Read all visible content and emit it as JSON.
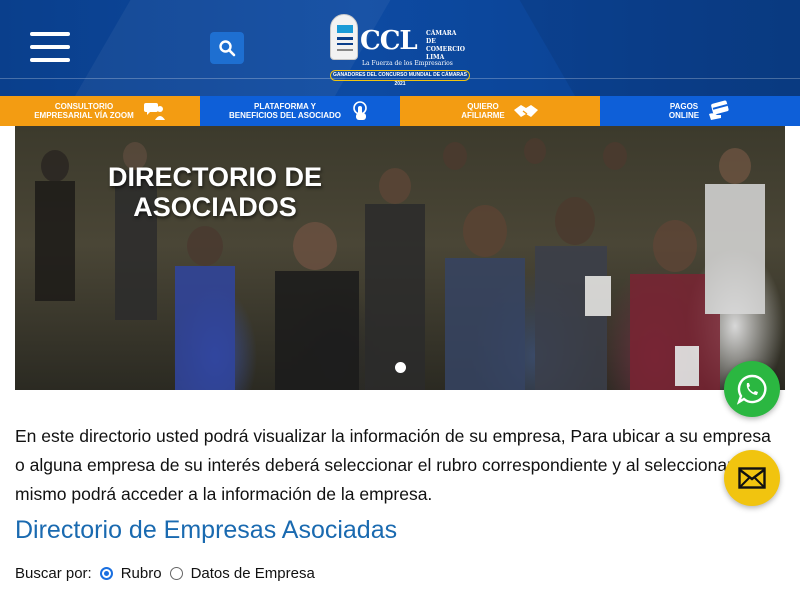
{
  "header": {
    "logo": {
      "wordmark": "CCL",
      "org_name_lines": [
        "CÁMARA",
        "DE COMERCIO",
        "LIMA"
      ],
      "tagline": "La Fuerza de los Empresarios",
      "ribbon": "GANADORES DEL CONCURSO MUNDIAL DE CÁMARAS 2021"
    },
    "menu_icon": "hamburger-icon",
    "search_icon": "search-icon"
  },
  "nav": [
    {
      "line1": "CONSULTORIO",
      "line2": "EMPRESARIAL VÍA ZOOM",
      "icon": "chat-icon",
      "color": "#f39c12"
    },
    {
      "line1": "PLATAFORMA Y",
      "line2": "BENEFICIOS DEL ASOCIADO",
      "icon": "touch-icon",
      "color": "#0e5fd8"
    },
    {
      "line1": "QUIERO",
      "line2": "AFILIARME",
      "icon": "handshake-icon",
      "color": "#f39c12"
    },
    {
      "line1": "PAGOS",
      "line2": "ONLINE",
      "icon": "card-icon",
      "color": "#0e5fd8"
    }
  ],
  "hero": {
    "title_line1": "DIRECTORIO DE",
    "title_line2": "ASOCIADOS"
  },
  "intro_text": "En este directorio usted podrá visualizar la información de su empresa, Para ubicar a su empresa o alguna empresa de su interés deberá seleccionar el rubro correspondiente y al seleccionar el mismo podrá acceder a la información de la empresa.",
  "section_title": "Directorio de Empresas Asociadas",
  "search": {
    "label": "Buscar por:",
    "options": [
      {
        "label": "Rubro",
        "selected": true
      },
      {
        "label": "Datos de Empresa",
        "selected": false
      }
    ]
  },
  "floating": {
    "whatsapp_icon": "whatsapp-icon",
    "mail_icon": "mail-icon"
  },
  "colors": {
    "header_blue": "#0d4aa2",
    "nav_orange": "#f39c12",
    "nav_blue": "#0e5fd8",
    "title_blue": "#1a6ab0",
    "whatsapp_green": "#2bb741",
    "mail_yellow": "#f1c40f"
  }
}
